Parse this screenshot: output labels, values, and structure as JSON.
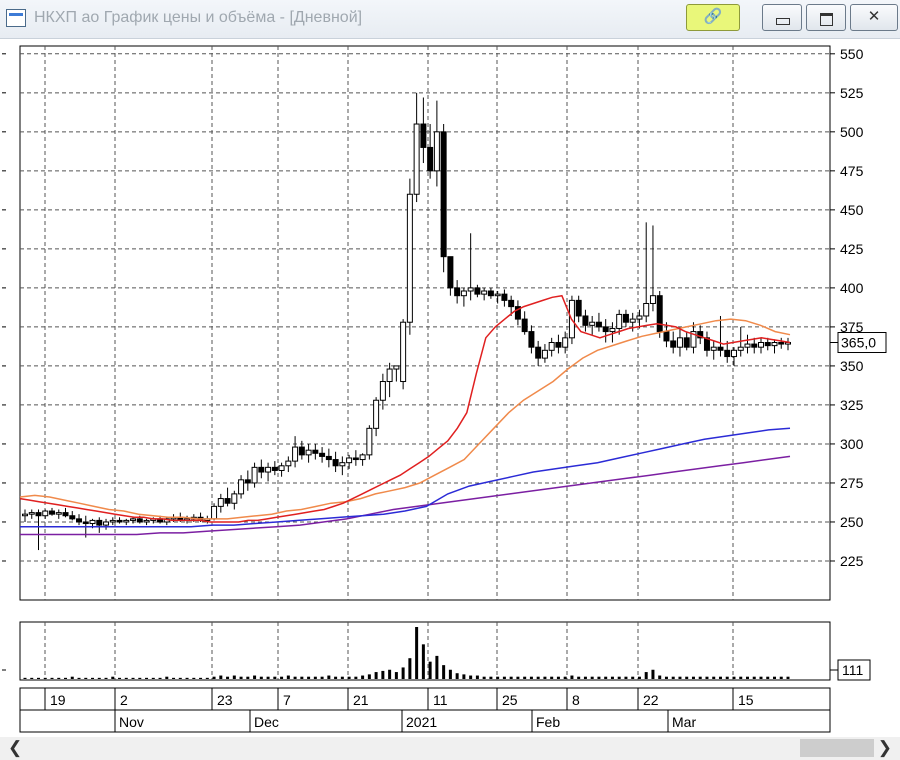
{
  "window": {
    "title": "НКХП ао График цены и объёма - [Дневной]",
    "buttons": {
      "link_icon": "link-icon",
      "minimize_icon": "minimize-icon",
      "maximize_icon": "maximize-icon",
      "close_icon": "close-icon"
    }
  },
  "colors": {
    "ma_fast": "#e02020",
    "ma_slow": "#f08a4b",
    "ma_long_1": "#2b2bd6",
    "ma_long_2": "#7b1fa2",
    "candles": "#000000",
    "grid": "#555555"
  },
  "chart_data": {
    "type": "candlestick",
    "price_axis": {
      "ylim": [
        200,
        555
      ],
      "ticks": [
        225,
        250,
        275,
        300,
        325,
        350,
        375,
        400,
        425,
        450,
        475,
        500,
        525,
        550
      ],
      "last_price_label": "365,0",
      "last_price": 365.0
    },
    "volume_axis": {
      "label": "111",
      "value": 111
    },
    "x_axis": {
      "day_labels": [
        "19",
        "2",
        "23",
        "7",
        "21",
        "11",
        "25",
        "8",
        "22",
        "15"
      ],
      "month_labels": [
        "Nov",
        "Dec",
        "2021",
        "Feb",
        "Mar"
      ]
    },
    "candles_ohlc": [
      [
        254,
        258,
        250,
        255
      ],
      [
        255,
        258,
        252,
        256
      ],
      [
        256,
        258,
        232,
        254
      ],
      [
        254,
        258,
        252,
        257
      ],
      [
        257,
        259,
        254,
        255
      ],
      [
        255,
        258,
        252,
        256
      ],
      [
        256,
        259,
        253,
        254
      ],
      [
        254,
        257,
        251,
        252
      ],
      [
        252,
        255,
        248,
        250
      ],
      [
        250,
        254,
        240,
        249
      ],
      [
        249,
        252,
        246,
        251
      ],
      [
        251,
        253,
        243,
        248
      ],
      [
        248,
        252,
        245,
        250
      ],
      [
        250,
        253,
        248,
        251
      ],
      [
        251,
        253,
        249,
        250
      ],
      [
        250,
        252,
        248,
        251
      ],
      [
        251,
        253,
        249,
        252
      ],
      [
        252,
        254,
        249,
        250
      ],
      [
        250,
        252,
        248,
        251
      ],
      [
        251,
        253,
        249,
        252
      ],
      [
        252,
        254,
        249,
        250
      ],
      [
        250,
        253,
        248,
        252
      ],
      [
        252,
        255,
        250,
        253
      ],
      [
        253,
        256,
        250,
        251
      ],
      [
        251,
        254,
        249,
        252
      ],
      [
        252,
        255,
        250,
        253
      ],
      [
        253,
        256,
        250,
        251
      ],
      [
        251,
        254,
        249,
        252
      ],
      [
        252,
        262,
        251,
        260
      ],
      [
        260,
        268,
        256,
        265
      ],
      [
        265,
        272,
        260,
        262
      ],
      [
        262,
        270,
        258,
        268
      ],
      [
        268,
        280,
        265,
        277
      ],
      [
        277,
        283,
        270,
        275
      ],
      [
        275,
        288,
        272,
        285
      ],
      [
        285,
        290,
        278,
        282
      ],
      [
        282,
        288,
        276,
        285
      ],
      [
        285,
        289,
        280,
        283
      ],
      [
        283,
        288,
        279,
        286
      ],
      [
        286,
        292,
        282,
        289
      ],
      [
        289,
        305,
        285,
        298
      ],
      [
        298,
        302,
        290,
        293
      ],
      [
        293,
        300,
        288,
        296
      ],
      [
        296,
        300,
        290,
        294
      ],
      [
        294,
        298,
        288,
        292
      ],
      [
        292,
        297,
        285,
        290
      ],
      [
        290,
        295,
        282,
        286
      ],
      [
        286,
        292,
        280,
        288
      ],
      [
        288,
        293,
        284,
        291
      ],
      [
        291,
        296,
        286,
        290
      ],
      [
        290,
        294,
        286,
        293
      ],
      [
        293,
        312,
        290,
        310
      ],
      [
        310,
        330,
        305,
        328
      ],
      [
        328,
        345,
        322,
        340
      ],
      [
        340,
        352,
        330,
        348
      ],
      [
        348,
        345,
        340,
        350
      ],
      [
        340,
        380,
        335,
        378
      ],
      [
        378,
        470,
        370,
        460
      ],
      [
        460,
        525,
        455,
        505
      ],
      [
        505,
        522,
        480,
        490
      ],
      [
        490,
        505,
        470,
        475
      ],
      [
        475,
        520,
        465,
        500
      ],
      [
        500,
        505,
        410,
        420
      ],
      [
        420,
        412,
        395,
        400
      ],
      [
        400,
        405,
        390,
        395
      ],
      [
        395,
        400,
        388,
        398
      ],
      [
        398,
        435,
        392,
        400
      ],
      [
        400,
        402,
        394,
        396
      ],
      [
        396,
        400,
        392,
        398
      ],
      [
        398,
        400,
        393,
        395
      ],
      [
        395,
        398,
        390,
        396
      ],
      [
        396,
        399,
        388,
        392
      ],
      [
        392,
        395,
        382,
        388
      ],
      [
        388,
        392,
        376,
        380
      ],
      [
        380,
        385,
        370,
        372
      ],
      [
        372,
        376,
        358,
        362
      ],
      [
        362,
        366,
        350,
        355
      ],
      [
        355,
        364,
        352,
        360
      ],
      [
        360,
        368,
        356,
        365
      ],
      [
        365,
        370,
        358,
        362
      ],
      [
        362,
        372,
        358,
        368
      ],
      [
        368,
        395,
        364,
        392
      ],
      [
        392,
        395,
        378,
        382
      ],
      [
        382,
        386,
        372,
        376
      ],
      [
        376,
        382,
        370,
        378
      ],
      [
        378,
        384,
        372,
        375
      ],
      [
        375,
        380,
        365,
        372
      ],
      [
        372,
        378,
        365,
        374
      ],
      [
        374,
        386,
        370,
        383
      ],
      [
        383,
        386,
        375,
        378
      ],
      [
        378,
        384,
        372,
        380
      ],
      [
        380,
        386,
        374,
        382
      ],
      [
        382,
        442,
        378,
        390
      ],
      [
        390,
        440,
        385,
        395
      ],
      [
        395,
        398,
        368,
        372
      ],
      [
        372,
        378,
        362,
        366
      ],
      [
        366,
        372,
        358,
        362
      ],
      [
        362,
        375,
        356,
        368
      ],
      [
        368,
        372,
        360,
        362
      ],
      [
        362,
        378,
        358,
        372
      ],
      [
        372,
        376,
        364,
        368
      ],
      [
        368,
        372,
        356,
        360
      ],
      [
        360,
        366,
        354,
        362
      ],
      [
        362,
        382,
        356,
        360
      ],
      [
        360,
        366,
        352,
        356
      ],
      [
        356,
        362,
        350,
        360
      ],
      [
        360,
        375,
        356,
        362
      ],
      [
        362,
        370,
        358,
        364
      ],
      [
        364,
        368,
        358,
        362
      ],
      [
        362,
        368,
        358,
        365
      ],
      [
        365,
        368,
        360,
        363
      ],
      [
        363,
        367,
        358,
        365
      ],
      [
        365,
        368,
        361,
        364
      ],
      [
        364,
        368,
        360,
        365
      ]
    ],
    "volume_relative": [
      1,
      1,
      1,
      1,
      1,
      1,
      1,
      2,
      1,
      1,
      1,
      1,
      1,
      2,
      1,
      1,
      1,
      1,
      1,
      1,
      1,
      2,
      1,
      1,
      1,
      1,
      1,
      1,
      2,
      3,
      2,
      3,
      2,
      2,
      3,
      2,
      2,
      2,
      2,
      3,
      2,
      2,
      2,
      2,
      2,
      3,
      2,
      2,
      2,
      2,
      3,
      4,
      6,
      7,
      8,
      6,
      10,
      18,
      45,
      30,
      15,
      20,
      12,
      8,
      5,
      4,
      3,
      3,
      2,
      2,
      2,
      2,
      2,
      2,
      2,
      2,
      2,
      2,
      2,
      2,
      2,
      3,
      2,
      2,
      2,
      2,
      2,
      2,
      2,
      2,
      2,
      2,
      6,
      8,
      3,
      2,
      2,
      2,
      2,
      2,
      2,
      2,
      2,
      2,
      2,
      2,
      2,
      2,
      2,
      2,
      2,
      2,
      2,
      2
    ],
    "ma_fast": [
      265,
      264,
      263,
      262,
      261,
      260,
      259,
      258,
      257,
      256,
      255,
      254,
      253,
      253,
      252,
      252,
      251,
      251,
      251,
      251,
      250,
      250,
      250,
      250,
      251,
      251,
      252,
      253,
      254,
      255,
      256,
      257,
      258,
      260,
      262,
      265,
      268,
      271,
      274,
      277,
      280,
      284,
      288,
      292,
      297,
      302,
      310,
      320,
      345,
      368,
      375,
      380,
      385,
      388,
      390,
      392,
      394,
      395,
      380,
      372,
      370,
      368,
      370,
      372,
      374,
      375,
      376,
      377,
      376,
      375,
      372,
      370,
      368,
      366,
      364,
      365,
      366,
      367,
      368,
      367,
      366,
      365
    ],
    "ma_slow": [
      266,
      267,
      266,
      264,
      262,
      260,
      258,
      257,
      255,
      254,
      253,
      253,
      252,
      252,
      252,
      253,
      254,
      255,
      257,
      258,
      260,
      262,
      263,
      265,
      268,
      270,
      272,
      275,
      280,
      285,
      290,
      300,
      310,
      320,
      328,
      334,
      340,
      348,
      355,
      360,
      363,
      366,
      369,
      371,
      373,
      375,
      377,
      379,
      380,
      379,
      376,
      372,
      370
    ],
    "ma_long_1": [
      247,
      247,
      247,
      247,
      247,
      247,
      247,
      247,
      247,
      248,
      248,
      249,
      250,
      251,
      252,
      253,
      254,
      255,
      257,
      260,
      268,
      273,
      276,
      279,
      282,
      284,
      286,
      288,
      291,
      294,
      297,
      300,
      303,
      305,
      307,
      309,
      310
    ],
    "ma_long_2": [
      242,
      242,
      242,
      242,
      242,
      242,
      243,
      243,
      244,
      245,
      246,
      247,
      248,
      250,
      252,
      255,
      258,
      260,
      262,
      264,
      266,
      268,
      270,
      272,
      274,
      276,
      278,
      280,
      282,
      284,
      286,
      288,
      290,
      292
    ]
  }
}
